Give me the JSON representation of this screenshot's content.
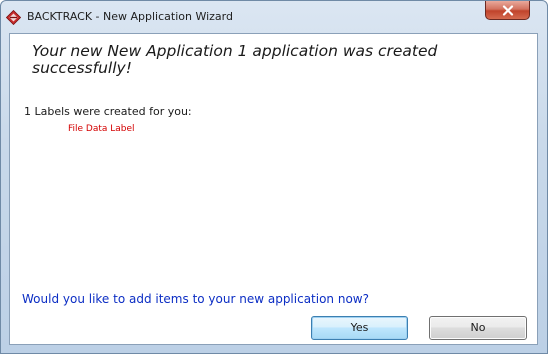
{
  "window": {
    "title": "BACKTRACK - New Application Wizard"
  },
  "dialog": {
    "headline": "Your new New Application 1 application was created successfully!",
    "labels_created_text": "1 Labels were created for you:",
    "labels": [
      "File Data Label"
    ],
    "question": "Would you like to add items to your new application now?",
    "yes_label": "Yes",
    "no_label": "No"
  },
  "icons": {
    "app": "backtrack-app-icon",
    "close": "close-icon"
  },
  "colors": {
    "headline_text": "#1a1a1a",
    "label_item": "#d40000",
    "question_text": "#0c2ec4",
    "close_button": "#c0432b"
  }
}
